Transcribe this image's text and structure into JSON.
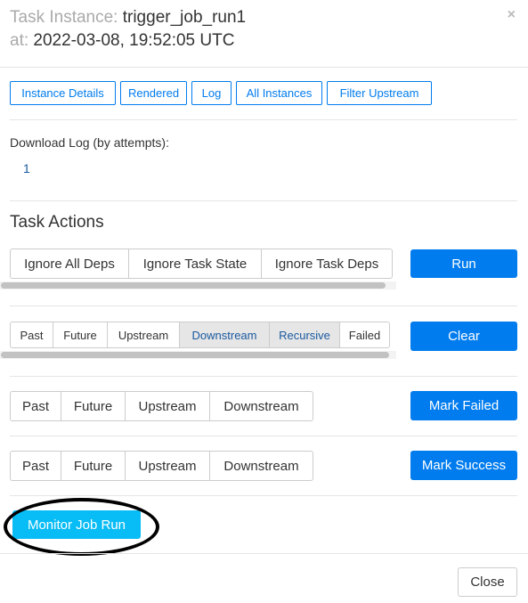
{
  "header": {
    "task_label": "Task Instance:",
    "task_value": "trigger_job_run1",
    "at_label": "at:",
    "at_value": "2022-03-08, 19:52:05 UTC",
    "close_icon": "×"
  },
  "nav": {
    "instance_details": "Instance Details",
    "rendered": "Rendered",
    "log": "Log",
    "all_instances": "All Instances",
    "filter_upstream": "Filter Upstream"
  },
  "download": {
    "label": "Download Log (by attempts):",
    "attempt": "1"
  },
  "task_actions": {
    "title": "Task Actions",
    "run_options": [
      "Ignore All Deps",
      "Ignore Task State",
      "Ignore Task Deps"
    ],
    "run_button": "Run",
    "clear_options": [
      "Past",
      "Future",
      "Upstream",
      "Downstream",
      "Recursive",
      "Failed"
    ],
    "clear_button": "Clear",
    "mark_failed_options": [
      "Past",
      "Future",
      "Upstream",
      "Downstream"
    ],
    "mark_failed_button": "Mark Failed",
    "mark_success_options": [
      "Past",
      "Future",
      "Upstream",
      "Downstream"
    ],
    "mark_success_button": "Mark Success"
  },
  "monitor_button": "Monitor Job Run",
  "footer": {
    "close_button": "Close"
  },
  "colors": {
    "primary": "#017cee",
    "monitor": "#08bcf5"
  }
}
